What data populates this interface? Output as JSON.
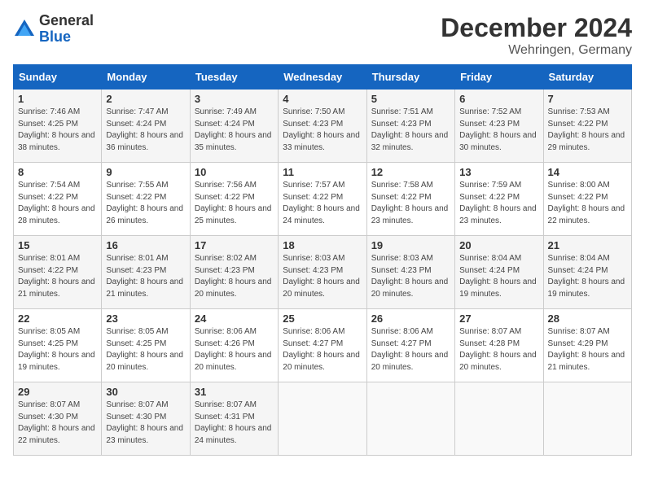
{
  "header": {
    "logo_general": "General",
    "logo_blue": "Blue",
    "month": "December 2024",
    "location": "Wehringen, Germany"
  },
  "days_of_week": [
    "Sunday",
    "Monday",
    "Tuesday",
    "Wednesday",
    "Thursday",
    "Friday",
    "Saturday"
  ],
  "weeks": [
    [
      {
        "day": 1,
        "sunrise": "7:46 AM",
        "sunset": "4:25 PM",
        "daylight": "8 hours and 38 minutes"
      },
      {
        "day": 2,
        "sunrise": "7:47 AM",
        "sunset": "4:24 PM",
        "daylight": "8 hours and 36 minutes"
      },
      {
        "day": 3,
        "sunrise": "7:49 AM",
        "sunset": "4:24 PM",
        "daylight": "8 hours and 35 minutes"
      },
      {
        "day": 4,
        "sunrise": "7:50 AM",
        "sunset": "4:23 PM",
        "daylight": "8 hours and 33 minutes"
      },
      {
        "day": 5,
        "sunrise": "7:51 AM",
        "sunset": "4:23 PM",
        "daylight": "8 hours and 32 minutes"
      },
      {
        "day": 6,
        "sunrise": "7:52 AM",
        "sunset": "4:23 PM",
        "daylight": "8 hours and 30 minutes"
      },
      {
        "day": 7,
        "sunrise": "7:53 AM",
        "sunset": "4:22 PM",
        "daylight": "8 hours and 29 minutes"
      }
    ],
    [
      {
        "day": 8,
        "sunrise": "7:54 AM",
        "sunset": "4:22 PM",
        "daylight": "8 hours and 28 minutes"
      },
      {
        "day": 9,
        "sunrise": "7:55 AM",
        "sunset": "4:22 PM",
        "daylight": "8 hours and 26 minutes"
      },
      {
        "day": 10,
        "sunrise": "7:56 AM",
        "sunset": "4:22 PM",
        "daylight": "8 hours and 25 minutes"
      },
      {
        "day": 11,
        "sunrise": "7:57 AM",
        "sunset": "4:22 PM",
        "daylight": "8 hours and 24 minutes"
      },
      {
        "day": 12,
        "sunrise": "7:58 AM",
        "sunset": "4:22 PM",
        "daylight": "8 hours and 23 minutes"
      },
      {
        "day": 13,
        "sunrise": "7:59 AM",
        "sunset": "4:22 PM",
        "daylight": "8 hours and 23 minutes"
      },
      {
        "day": 14,
        "sunrise": "8:00 AM",
        "sunset": "4:22 PM",
        "daylight": "8 hours and 22 minutes"
      }
    ],
    [
      {
        "day": 15,
        "sunrise": "8:01 AM",
        "sunset": "4:22 PM",
        "daylight": "8 hours and 21 minutes"
      },
      {
        "day": 16,
        "sunrise": "8:01 AM",
        "sunset": "4:23 PM",
        "daylight": "8 hours and 21 minutes"
      },
      {
        "day": 17,
        "sunrise": "8:02 AM",
        "sunset": "4:23 PM",
        "daylight": "8 hours and 20 minutes"
      },
      {
        "day": 18,
        "sunrise": "8:03 AM",
        "sunset": "4:23 PM",
        "daylight": "8 hours and 20 minutes"
      },
      {
        "day": 19,
        "sunrise": "8:03 AM",
        "sunset": "4:23 PM",
        "daylight": "8 hours and 20 minutes"
      },
      {
        "day": 20,
        "sunrise": "8:04 AM",
        "sunset": "4:24 PM",
        "daylight": "8 hours and 19 minutes"
      },
      {
        "day": 21,
        "sunrise": "8:04 AM",
        "sunset": "4:24 PM",
        "daylight": "8 hours and 19 minutes"
      }
    ],
    [
      {
        "day": 22,
        "sunrise": "8:05 AM",
        "sunset": "4:25 PM",
        "daylight": "8 hours and 19 minutes"
      },
      {
        "day": 23,
        "sunrise": "8:05 AM",
        "sunset": "4:25 PM",
        "daylight": "8 hours and 20 minutes"
      },
      {
        "day": 24,
        "sunrise": "8:06 AM",
        "sunset": "4:26 PM",
        "daylight": "8 hours and 20 minutes"
      },
      {
        "day": 25,
        "sunrise": "8:06 AM",
        "sunset": "4:27 PM",
        "daylight": "8 hours and 20 minutes"
      },
      {
        "day": 26,
        "sunrise": "8:06 AM",
        "sunset": "4:27 PM",
        "daylight": "8 hours and 20 minutes"
      },
      {
        "day": 27,
        "sunrise": "8:07 AM",
        "sunset": "4:28 PM",
        "daylight": "8 hours and 20 minutes"
      },
      {
        "day": 28,
        "sunrise": "8:07 AM",
        "sunset": "4:29 PM",
        "daylight": "8 hours and 21 minutes"
      }
    ],
    [
      {
        "day": 29,
        "sunrise": "8:07 AM",
        "sunset": "4:30 PM",
        "daylight": "8 hours and 22 minutes"
      },
      {
        "day": 30,
        "sunrise": "8:07 AM",
        "sunset": "4:30 PM",
        "daylight": "8 hours and 23 minutes"
      },
      {
        "day": 31,
        "sunrise": "8:07 AM",
        "sunset": "4:31 PM",
        "daylight": "8 hours and 24 minutes"
      },
      null,
      null,
      null,
      null
    ]
  ]
}
